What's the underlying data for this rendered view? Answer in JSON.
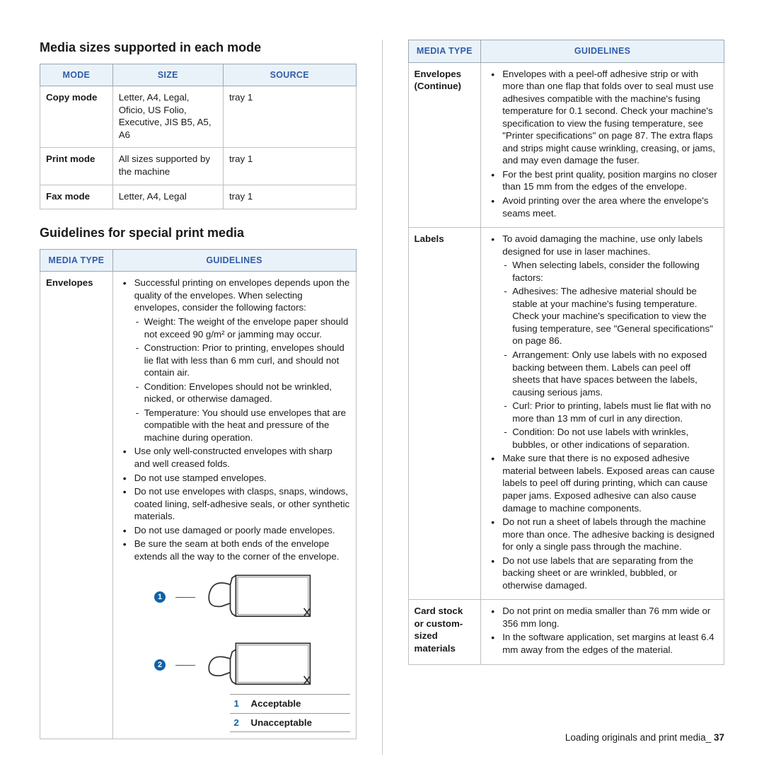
{
  "section1": {
    "heading": "Media sizes supported in each mode",
    "headers": {
      "mode": "MODE",
      "size": "SIZE",
      "source": "SOURCE"
    },
    "rows": [
      {
        "mode": "Copy mode",
        "size": "Letter, A4, Legal, Oficio, US Folio, Executive, JIS B5, A5, A6",
        "source": "tray 1"
      },
      {
        "mode": "Print mode",
        "size": "All sizes supported by the machine",
        "source": "tray 1"
      },
      {
        "mode": "Fax mode",
        "size": "Letter, A4, Legal",
        "source": "tray 1"
      }
    ]
  },
  "section2": {
    "heading": "Guidelines for special print media",
    "headers": {
      "type": "MEDIA TYPE",
      "guidelines": "GUIDELINES"
    },
    "envelopes": {
      "label": "Envelopes",
      "b1": "Successful printing on envelopes depends upon the quality of the envelopes. When selecting envelopes, consider the following factors:",
      "d1": "Weight: The weight of the envelope paper should not exceed 90 g/m² or jamming may occur.",
      "d2": "Construction: Prior to printing, envelopes should lie flat with less than 6 mm curl, and should not contain air.",
      "d3": "Condition: Envelopes should not be wrinkled, nicked, or otherwise damaged.",
      "d4": "Temperature: You should use envelopes that are compatible with the heat and pressure of the machine during operation.",
      "b2": "Use only well-constructed envelopes with sharp and well creased folds.",
      "b3": "Do not use stamped envelopes.",
      "b4": "Do not use envelopes with clasps, snaps, windows, coated lining, self-adhesive seals, or other synthetic materials.",
      "b5": "Do not use damaged or poorly made envelopes.",
      "b6": "Be sure the seam at both ends of the envelope extends all the way to the corner of the envelope."
    },
    "legend": {
      "l1": "Acceptable",
      "l2": "Unacceptable",
      "n1": "1",
      "n2": "2"
    }
  },
  "right": {
    "headers": {
      "type": "MEDIA TYPE",
      "guidelines": "GUIDELINES"
    },
    "envcont": {
      "label": "Envelopes (Continue)",
      "b1": "Envelopes with a peel-off adhesive strip or with more than one flap that folds over to seal must use adhesives compatible with the machine's fusing temperature for 0.1 second. Check your machine's specification to view the fusing temperature, see \"Printer specifications\" on page 87. The extra flaps and strips might cause wrinkling, creasing, or jams, and may even damage the fuser.",
      "b2": "For the best print quality, position margins no closer than 15 mm from the edges of the envelope.",
      "b3": "Avoid printing over the area where the envelope's seams meet."
    },
    "labels": {
      "label": "Labels",
      "b1": "To avoid damaging the machine, use only labels designed for use in laser machines.",
      "d0": "When selecting labels, consider the following factors:",
      "d1": "Adhesives: The adhesive material should be stable at your machine's fusing temperature. Check your machine's specification to view the fusing temperature, see \"General specifications\" on page 86.",
      "d2": "Arrangement: Only use labels with no exposed backing between them. Labels can peel off sheets that have spaces between the labels, causing serious jams.",
      "d3": "Curl: Prior to printing, labels must lie flat with no more than 13 mm of curl in any direction.",
      "d4": "Condition: Do not use labels with wrinkles, bubbles, or other indications of separation.",
      "b2": "Make sure that there is no exposed adhesive material between labels. Exposed areas can cause labels to peel off during printing, which can cause paper jams. Exposed adhesive can also cause damage to machine components.",
      "b3": "Do not run a sheet of labels through the machine more than once. The adhesive backing is designed for only a single pass through the machine.",
      "b4": "Do not use labels that are separating from the backing sheet or are wrinkled, bubbled, or otherwise damaged."
    },
    "card": {
      "label": "Card stock or custom-sized materials",
      "b1": "Do not print on media smaller than 76 mm wide or 356 mm long.",
      "b2": "In the software application, set margins at least 6.4 mm away from the edges of the material."
    }
  },
  "footer": {
    "text": "Loading originals and print media_",
    "page": "37"
  },
  "badges": {
    "one": "1",
    "two": "2"
  }
}
